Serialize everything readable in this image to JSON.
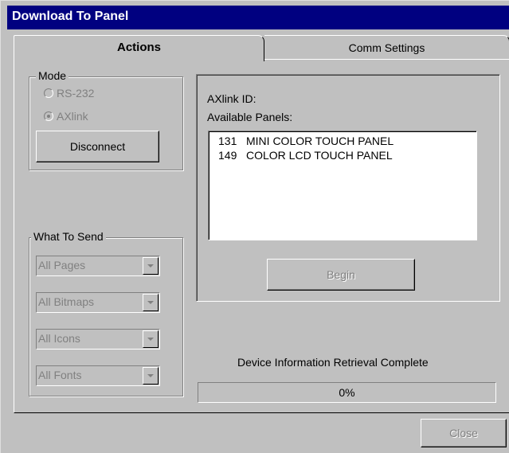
{
  "window": {
    "title": "Download To Panel"
  },
  "tabs": [
    {
      "label": "Actions",
      "active": true
    },
    {
      "label": "Comm Settings",
      "active": false
    }
  ],
  "mode": {
    "legend": "Mode",
    "options": [
      {
        "label": "RS-232",
        "checked": false,
        "enabled": false
      },
      {
        "label": "AXlink",
        "checked": true,
        "enabled": false
      }
    ],
    "disconnect_label": "Disconnect"
  },
  "what_to_send": {
    "legend": "What To Send",
    "combos": [
      {
        "value": "All Pages"
      },
      {
        "value": "All Bitmaps"
      },
      {
        "value": "All Icons"
      },
      {
        "value": "All Fonts"
      }
    ]
  },
  "device": {
    "axlink_id_label": "AXlink ID:",
    "available_panels_label": "Available Panels:",
    "panels": [
      {
        "id": "131",
        "name": "MINI COLOR TOUCH PANEL"
      },
      {
        "id": "149",
        "name": "COLOR LCD TOUCH PANEL"
      }
    ],
    "begin_label": "Begin"
  },
  "status": {
    "message": "Device Information Retrieval Complete",
    "progress_text": "0%",
    "progress_fraction": 0
  },
  "close_label": "Close",
  "colors": {
    "titlebar": "#000080",
    "face": "#c0c0c0"
  }
}
